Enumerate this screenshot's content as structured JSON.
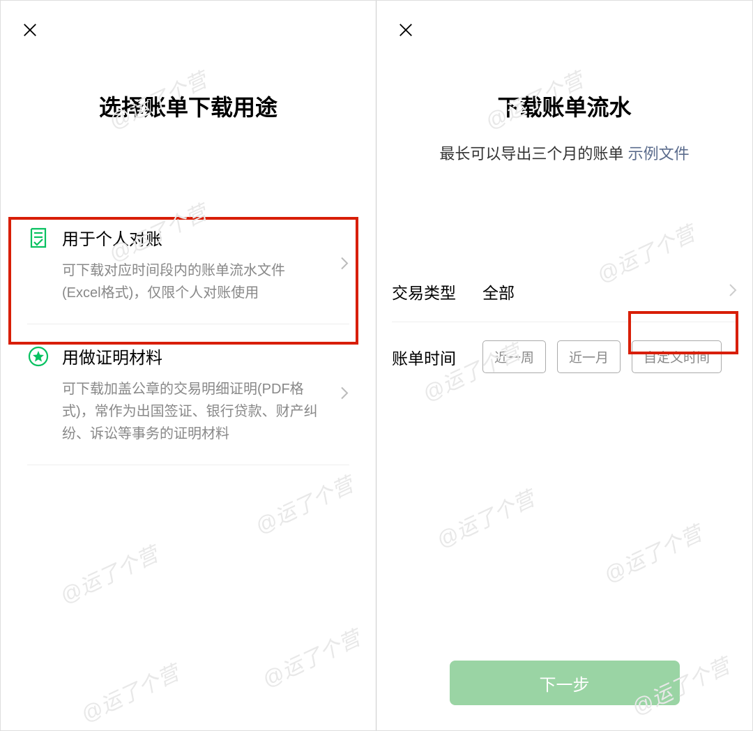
{
  "watermark": "@运了个营",
  "left": {
    "title": "选择账单下载用途",
    "options": [
      {
        "title": "用于个人对账",
        "desc": "可下载对应时间段内的账单流水文件(Excel格式)，仅限个人对账使用"
      },
      {
        "title": "用做证明材料",
        "desc": "可下载加盖公章的交易明细证明(PDF格式)，常作为出国签证、银行贷款、财产纠纷、诉讼等事务的证明材料"
      }
    ]
  },
  "right": {
    "title": "下载账单流水",
    "subtitle_text": "最长可以导出三个月的账单",
    "subtitle_link": "示例文件",
    "rows": {
      "type_label": "交易类型",
      "type_value": "全部",
      "time_label": "账单时间",
      "time_options": [
        "近一周",
        "近一月",
        "自定义时间"
      ]
    },
    "next_button": "下一步"
  }
}
